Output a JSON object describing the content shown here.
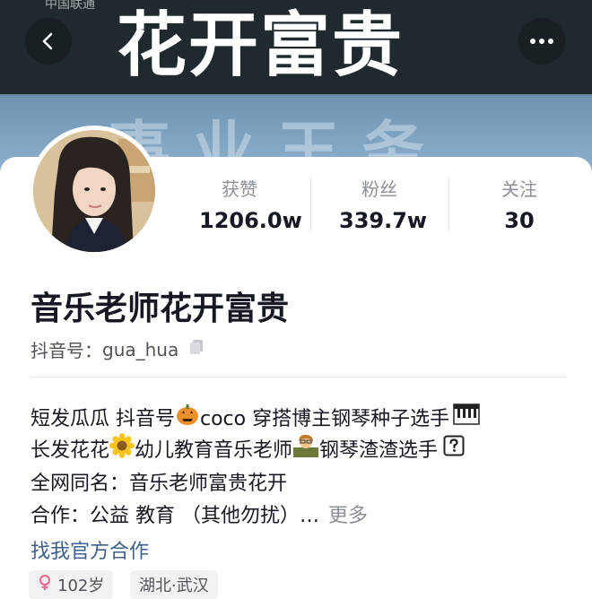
{
  "banner": {
    "top_left": "中国联通",
    "big_text": "花开富贵",
    "faint_text": "事 业 王 务"
  },
  "profile": {
    "name": "音乐老师花开富贵",
    "douyin_id_label": "抖音号：",
    "douyin_id": "gua_hua"
  },
  "stats": [
    {
      "label": "获赞",
      "value": "1206.0w"
    },
    {
      "label": "粉丝",
      "value": "339.7w"
    },
    {
      "label": "关注",
      "value": "30"
    }
  ],
  "bio": {
    "line1_a": "短发瓜瓜 抖音号",
    "line1_b": "coco 穿搭博主钢琴种子选手",
    "line2_a": "长发花花",
    "line2_b": "幼儿教育音乐老师",
    "line2_c": "钢琴渣渣选手",
    "line3": "全网同名：音乐老师富贵花开",
    "line4": "合作：公益 教育 （其他勿扰）…",
    "more": "更多"
  },
  "official_link": "找我官方合作",
  "tags": [
    {
      "text": "102岁"
    },
    {
      "text": "湖北·武汉"
    }
  ],
  "icons": {
    "back": "chevron-left-icon",
    "more": "more-dots-icon",
    "copy": "copy-icon",
    "pumpkin": "pumpkin-emoji",
    "piano": "piano-emoji",
    "sunflower": "sunflower-emoji",
    "teacher": "teacher-emoji",
    "question": "question-box-emoji",
    "female": "female-sign-icon"
  },
  "colors": {
    "link": "#3e5f8c",
    "text_primary": "#161823",
    "text_secondary": "#8a8f99"
  }
}
